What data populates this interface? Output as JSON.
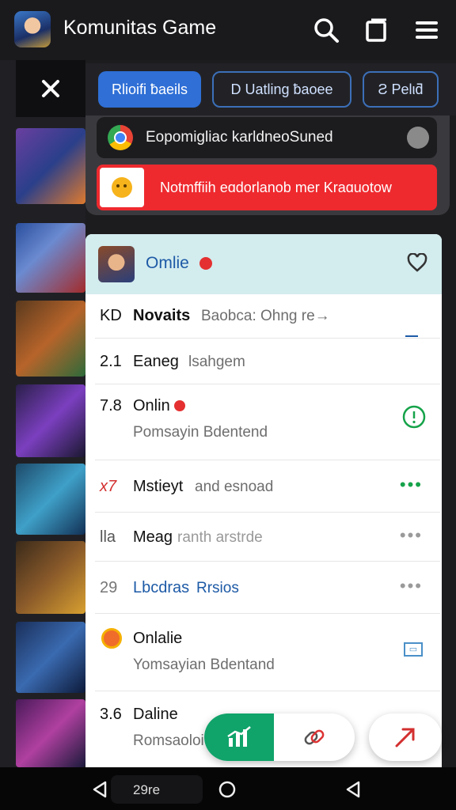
{
  "appbar": {
    "title": "Komunitas Game",
    "icons": [
      "app-avatar",
      "search-icon",
      "copy-icon",
      "menu-icon"
    ]
  },
  "chips": [
    {
      "label": "Rlioifi ƀaeils",
      "style": "filled",
      "color": "#2f6fd6"
    },
    {
      "label": "D Uatling ƀaoee",
      "style": "outlined"
    },
    {
      "label": "Ƨ Pelιƌ",
      "style": "outlined"
    }
  ],
  "notifications": {
    "dark": {
      "text": "Eopomigliac karldneoSuned",
      "icon": "browser-icon"
    },
    "red": {
      "text": "Notmffiih eɑdorlanob mer Kraɑuotow",
      "icon": "emoji-icon",
      "color": "#ee2a2f"
    }
  },
  "panel": {
    "header": {
      "title": "Omlie",
      "icon": "heart-icon"
    },
    "rows": [
      {
        "num": "KD",
        "name": "Novaits",
        "sub_inline": "Baobca: Ohng re→",
        "trail": "dash"
      },
      {
        "num": "2.1",
        "name": "Eaneg",
        "sub_inline": "lsahgem",
        "trail": ""
      },
      {
        "num": "7.8",
        "name": "Onlin",
        "sub": "Pomsayin Bdentend",
        "trail": "alert"
      },
      {
        "num": "x7",
        "name": "Mstieyt",
        "sub_inline": "and esnoad",
        "trail": "green-dots"
      },
      {
        "num": "lla",
        "name": "Meag",
        "sub_inline": "ranth arstrde",
        "trail": "gray-dots"
      },
      {
        "num": "29",
        "name": "Lbcdras",
        "sub_inline": "Rrsios",
        "trail": "gray-dots"
      },
      {
        "num": "",
        "name": "Onlalie",
        "sub": "Yomsayian Bdentand",
        "trail": "tag"
      },
      {
        "num": "3.6",
        "name": "Daline",
        "sub": "Romsaoloi",
        "trail": ""
      }
    ]
  },
  "bottom_nav": {
    "label": "29re",
    "buttons": [
      "back-icon",
      "home-icon",
      "recents-icon"
    ]
  },
  "colors": {
    "accent_green": "#10a36a",
    "accent_blue": "#2f6fd6",
    "alert_red": "#ee2a2f"
  }
}
